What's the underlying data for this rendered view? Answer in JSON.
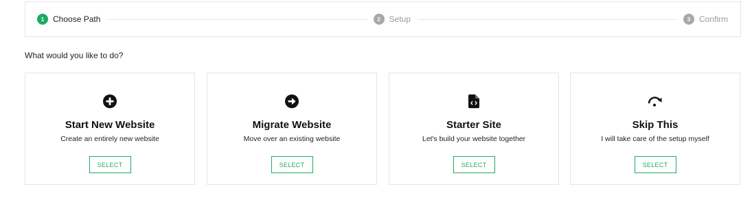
{
  "stepper": {
    "steps": [
      {
        "num": "1",
        "label": "Choose Path"
      },
      {
        "num": "2",
        "label": "Setup"
      },
      {
        "num": "3",
        "label": "Confirm"
      }
    ]
  },
  "question": "What would you like to do?",
  "cards": [
    {
      "icon": "plus-circle-icon",
      "title": "Start New Website",
      "desc": "Create an entirely new website",
      "button": "SELECT"
    },
    {
      "icon": "arrow-right-circle-icon",
      "title": "Migrate Website",
      "desc": "Move over an existing website",
      "button": "SELECT"
    },
    {
      "icon": "code-file-icon",
      "title": "Starter Site",
      "desc": "Let's build your website together",
      "button": "SELECT"
    },
    {
      "icon": "skip-redo-icon",
      "title": "Skip This",
      "desc": "I will take care of the setup myself",
      "button": "SELECT"
    }
  ],
  "colors": {
    "accent": "#1eaa61",
    "inactive": "#a8a8a8",
    "border": "#e4e4e4"
  }
}
